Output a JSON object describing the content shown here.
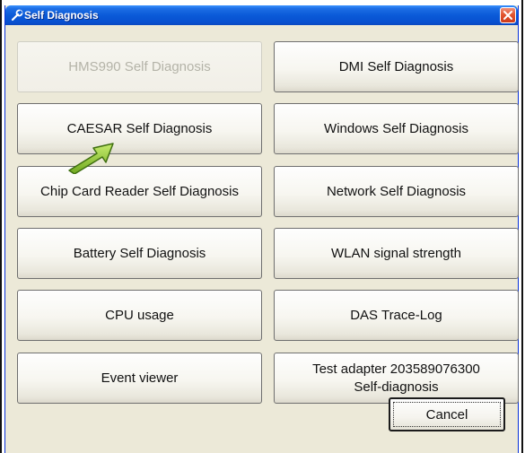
{
  "window": {
    "title": "Self Diagnosis"
  },
  "buttons": {
    "hms990": "HMS990 Self Diagnosis",
    "dmi": "DMI Self Diagnosis",
    "caesar": "CAESAR Self Diagnosis",
    "windows": "Windows Self Diagnosis",
    "chip_card": "Chip Card Reader Self Diagnosis",
    "network": "Network Self Diagnosis",
    "battery": "Battery Self Diagnosis",
    "wlan": "WLAN signal strength",
    "cpu": "CPU usage",
    "das_trace": "DAS Trace-Log",
    "event_viewer": "Event viewer",
    "test_adapter": "Test adapter 203589076300\nSelf-diagnosis",
    "cancel": "Cancel"
  },
  "icons": {
    "title_icon": "wrench-icon",
    "close_icon": "close-icon",
    "pointer": "green-arrow-icon"
  },
  "colors": {
    "titlebar_blue": "#0a5ad8",
    "dialog_bg": "#ece9d8",
    "close_red": "#e2552f",
    "disabled_text": "#b4b3a8",
    "arrow_green": "#8cc43a"
  }
}
